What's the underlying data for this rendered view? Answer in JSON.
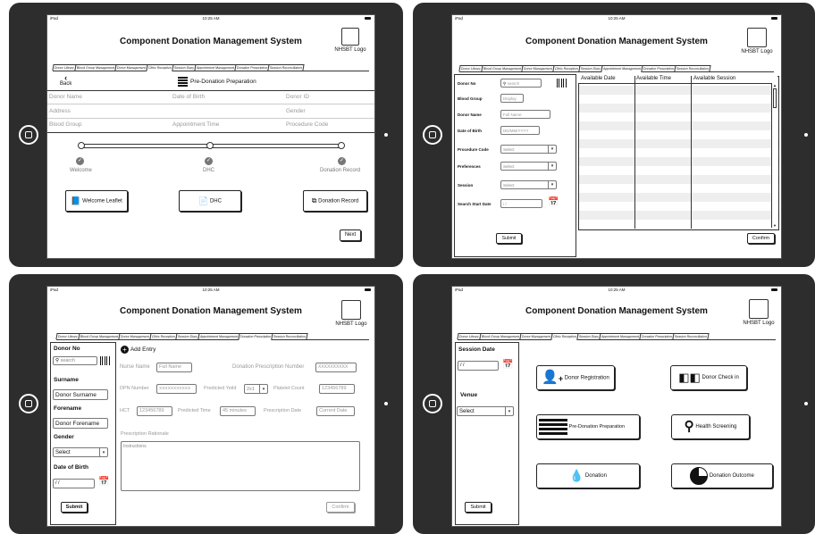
{
  "status": {
    "device": "iPad",
    "time": "10:25 AM"
  },
  "app_title": "Component Donation Management System",
  "logo_label": "NHSBT Logo",
  "tabs": [
    "Donor Library",
    "Blood Group Management",
    "Donor Management",
    "Clinic Reception",
    "Session Diary",
    "Appointment Management",
    "Donation Prescription",
    "Session Reconciliation"
  ],
  "screen1": {
    "back": "Back",
    "heading": "Pre-Donation Preparation",
    "fields": [
      "Donor Name",
      "Date of Birth",
      "Donor ID",
      "Address",
      "Gender",
      "Blood Group",
      "Appointment Time",
      "Procedure Code"
    ],
    "steps": [
      "Welcome",
      "DHC",
      "Donation Record"
    ],
    "buttons": [
      "Welcome Leaflet",
      "DHC",
      "Donation Record"
    ],
    "next": "Next"
  },
  "screen2": {
    "labels": [
      "Donor No",
      "Blood Group",
      "Donor Name",
      "Date of Birth",
      "Procedure Code",
      "Preferences",
      "Session",
      "Search Start Date"
    ],
    "search_placeholder": "search",
    "blood_group": "Display",
    "name_placeholder": "Full Name",
    "dob_placeholder": "DD/MM/YYYY",
    "select": "Select",
    "date": "/ /",
    "submit": "Submit",
    "columns": [
      "Available Date",
      "Available Time",
      "Available Session"
    ],
    "confirm": "Confirm"
  },
  "screen3": {
    "labels": [
      "Donor No",
      "Surname",
      "Forename",
      "Gender",
      "Date of Birth"
    ],
    "search_placeholder": "search",
    "surname": "Donor Surname",
    "forename": "Donor Forename",
    "select": "Select",
    "date": "/ /",
    "submit": "Submit",
    "add_entry": "Add Entry",
    "nurse_name": "Nurse Name",
    "full_name": "Full Name",
    "prescription_number_label": "Donation Prescription Number",
    "prescription_number": "XXXXXXXXXX",
    "dpn_label": "DPN Number",
    "dpn": "XXXXXXXXXXX",
    "yield_label": "Predicted Yeild",
    "yield": "2x1",
    "platelet_label": "Platelet Count",
    "platelet": "123456789",
    "hct_label": "HCT",
    "hct": "123456789",
    "time_label": "Predicted Time",
    "time": "45 minutes",
    "date_label": "Prescription Date",
    "current_date": "Current Date",
    "rationale_label": "Prescription Rationale",
    "instructions": "Instructions",
    "confirm": "Confirm"
  },
  "screen4": {
    "session_date": "Session Date",
    "date": "/ /",
    "venue": "Venue",
    "select": "Select",
    "submit": "Submit",
    "tiles": [
      "Donor Registration",
      "Donor Check in",
      "Pre-Donation Preparation",
      "Health Screening",
      "Donation",
      "Donation Outcome"
    ]
  }
}
